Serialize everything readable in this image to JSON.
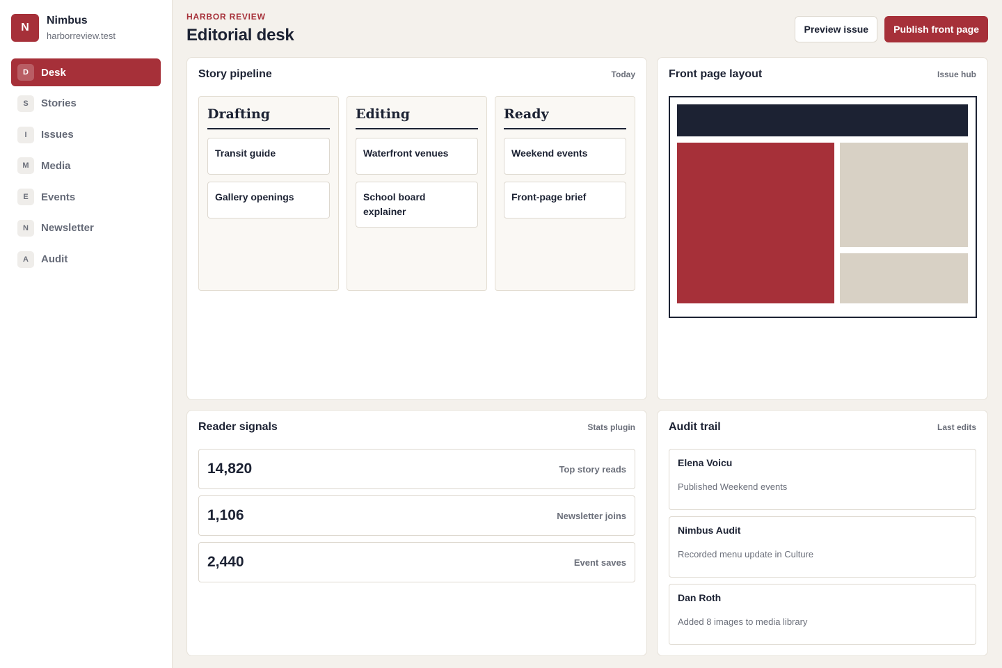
{
  "app": {
    "logo_letter": "N",
    "name": "Nimbus",
    "domain": "harborreview.test"
  },
  "sidebar": {
    "items": [
      {
        "letter": "D",
        "label": "Desk",
        "active": true
      },
      {
        "letter": "S",
        "label": "Stories"
      },
      {
        "letter": "I",
        "label": "Issues"
      },
      {
        "letter": "M",
        "label": "Media"
      },
      {
        "letter": "E",
        "label": "Events"
      },
      {
        "letter": "N",
        "label": "Newsletter"
      },
      {
        "letter": "A",
        "label": "Audit"
      }
    ]
  },
  "header": {
    "eyebrow": "HARBOR REVIEW",
    "title": "Editorial desk",
    "preview_label": "Preview issue",
    "publish_label": "Publish front page"
  },
  "pipeline": {
    "title": "Story pipeline",
    "meta": "Today",
    "columns": [
      {
        "title": "Drafting",
        "cards": [
          "Transit guide",
          "Gallery openings"
        ]
      },
      {
        "title": "Editing",
        "cards": [
          "Waterfront venues",
          "School board explainer"
        ]
      },
      {
        "title": "Ready",
        "cards": [
          "Weekend events",
          "Front-page brief"
        ]
      }
    ]
  },
  "layout": {
    "title": "Front page layout",
    "meta": "Issue hub"
  },
  "signals": {
    "title": "Reader signals",
    "meta": "Stats plugin",
    "rows": [
      {
        "value": "14,820",
        "label": "Top story reads"
      },
      {
        "value": "1,106",
        "label": "Newsletter joins"
      },
      {
        "value": "2,440",
        "label": "Event saves"
      }
    ]
  },
  "audit": {
    "title": "Audit trail",
    "meta": "Last edits",
    "items": [
      {
        "name": "Elena Voicu",
        "desc": "Published Weekend events"
      },
      {
        "name": "Nimbus Audit",
        "desc": "Recorded menu update in Culture"
      },
      {
        "name": "Dan Roth",
        "desc": "Added 8 images to media library"
      }
    ]
  },
  "colors": {
    "accent": "#a63039",
    "ink": "#1c2233",
    "muted": "#6b6f7a",
    "background": "#f4f1ec",
    "layout_block": "#d8d1c5"
  }
}
